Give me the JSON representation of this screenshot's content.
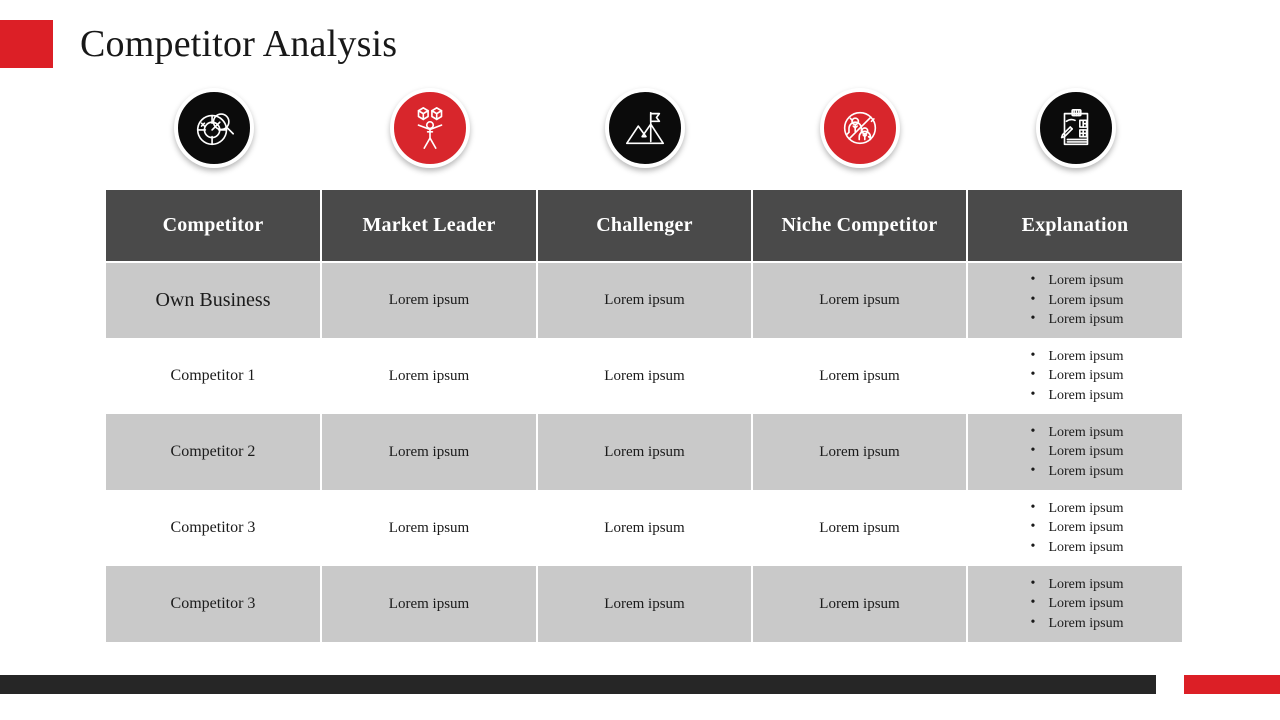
{
  "slide": {
    "title": "Competitor Analysis",
    "accent_color": "#dc1f26",
    "dark_color": "#262626",
    "header_row_color": "#4a4a4a",
    "shaded_row_color": "#c9c9c9"
  },
  "icons": [
    {
      "name": "target-search-icon",
      "style": "dark",
      "label": "Target with magnifier"
    },
    {
      "name": "juggling-products-icon",
      "style": "red",
      "label": "Person juggling boxes"
    },
    {
      "name": "mountain-flag-icon",
      "style": "dark",
      "label": "Mountain with flag"
    },
    {
      "name": "no-competitors-icon",
      "style": "red",
      "label": "Prohibited people sign"
    },
    {
      "name": "report-analysis-icon",
      "style": "dark",
      "label": "Clipboard report with charts"
    }
  ],
  "table": {
    "headers": [
      "Competitor",
      "Market Leader",
      "Challenger",
      "Niche Competitor",
      "Explanation"
    ],
    "rows": [
      {
        "shaded": true,
        "name": "Own Business",
        "market_leader": "Lorem ipsum",
        "challenger": "Lorem ipsum",
        "niche": "Lorem ipsum",
        "explanation": [
          "Lorem ipsum",
          "Lorem ipsum",
          "Lorem ipsum"
        ]
      },
      {
        "shaded": false,
        "name": "Competitor 1",
        "market_leader": "Lorem ipsum",
        "challenger": "Lorem ipsum",
        "niche": "Lorem ipsum",
        "explanation": [
          "Lorem ipsum",
          "Lorem ipsum",
          "Lorem ipsum"
        ]
      },
      {
        "shaded": true,
        "name": "Competitor 2",
        "market_leader": "Lorem ipsum",
        "challenger": "Lorem ipsum",
        "niche": "Lorem ipsum",
        "explanation": [
          "Lorem ipsum",
          "Lorem ipsum",
          "Lorem ipsum"
        ]
      },
      {
        "shaded": false,
        "name": "Competitor 3",
        "market_leader": "Lorem ipsum",
        "challenger": "Lorem ipsum",
        "niche": "Lorem ipsum",
        "explanation": [
          "Lorem ipsum",
          "Lorem ipsum",
          "Lorem ipsum"
        ]
      },
      {
        "shaded": true,
        "name": "Competitor 3",
        "market_leader": "Lorem ipsum",
        "challenger": "Lorem ipsum",
        "niche": "Lorem ipsum",
        "explanation": [
          "Lorem ipsum",
          "Lorem ipsum",
          "Lorem ipsum"
        ]
      }
    ]
  }
}
